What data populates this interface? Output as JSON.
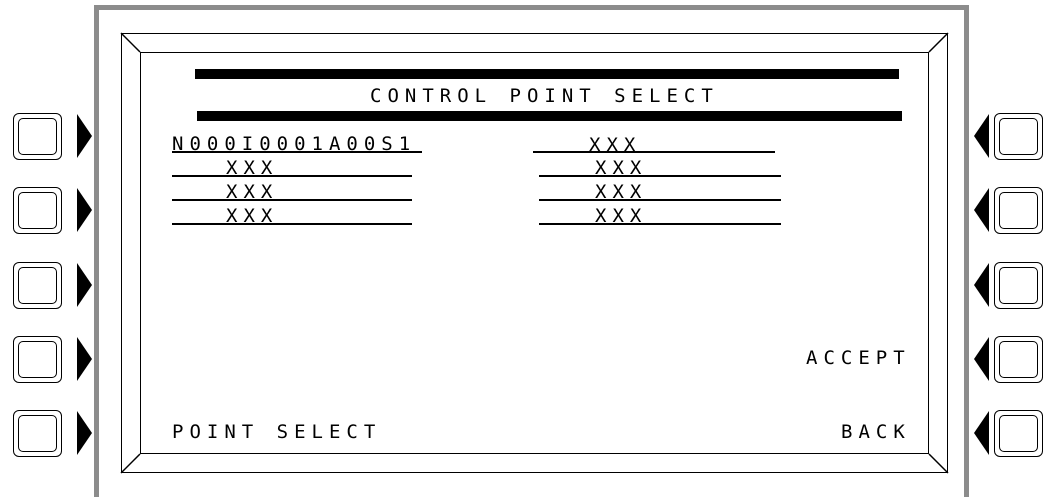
{
  "screen": {
    "title": "CONTROL POINT SELECT",
    "left_column": [
      "N000I0001A00S1",
      "XXX",
      "XXX",
      "XXX"
    ],
    "right_column": [
      "XXX",
      "XXX",
      "XXX",
      "XXX"
    ],
    "accept_label": "ACCEPT",
    "point_select_label": "POINT SELECT",
    "back_label": "BACK"
  }
}
